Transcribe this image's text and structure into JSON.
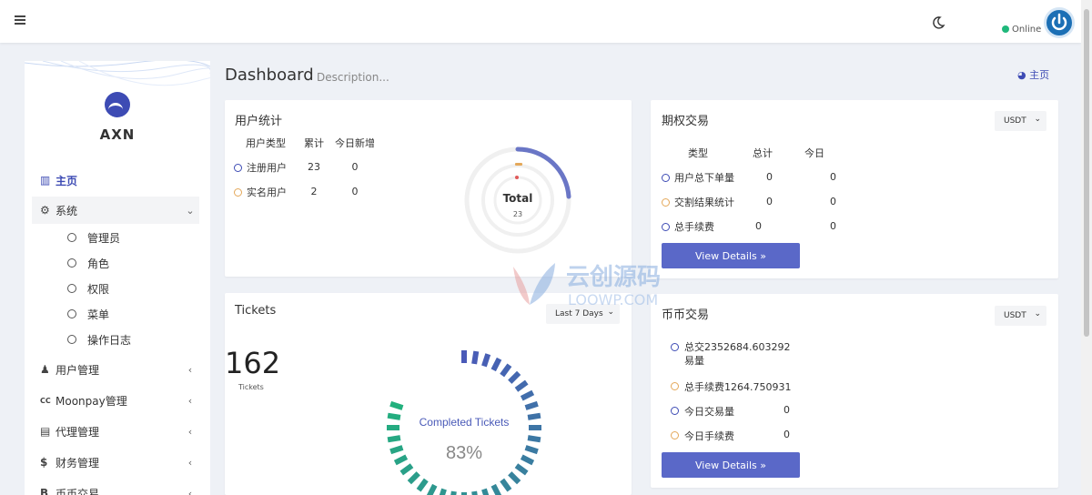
{
  "header": {
    "status": "Online"
  },
  "sidebar": {
    "brand": "AXN",
    "items": [
      {
        "label": "主页",
        "icon": "bar-chart-icon"
      },
      {
        "label": "系统",
        "icon": "gear-icon"
      },
      {
        "label": "用户管理",
        "icon": "users-icon"
      },
      {
        "label": "Moonpay管理",
        "icon": "cc-icon"
      },
      {
        "label": "代理管理",
        "icon": "id-card-icon"
      },
      {
        "label": "财务管理",
        "icon": "dollar-icon"
      },
      {
        "label": "币币交易",
        "icon": "bitcoin-icon"
      }
    ],
    "system_sub": [
      "管理员",
      "角色",
      "权限",
      "菜单",
      "操作日志"
    ]
  },
  "page": {
    "title": "Dashboard",
    "description": "Description...",
    "breadcrumb": "主页"
  },
  "user_stats": {
    "title": "用户统计",
    "headers": [
      "用户类型",
      "累计",
      "今日新增"
    ],
    "rows": [
      {
        "type": "注册用户",
        "total": "23",
        "today": "0"
      },
      {
        "type": "实名用户",
        "total": "2",
        "today": "0"
      }
    ],
    "donut_label": "Total",
    "donut_value": "23"
  },
  "options_trade": {
    "title": "期权交易",
    "currency": "USDT",
    "headers": [
      "类型",
      "总计",
      "今日"
    ],
    "rows": [
      {
        "type": "用户总下单量",
        "total": "0",
        "today": "0"
      },
      {
        "type": "交割结果统计",
        "total": "0",
        "today": "0"
      },
      {
        "type": "总手续费",
        "total": "0",
        "today": "0"
      }
    ],
    "button": "View Details »"
  },
  "tickets": {
    "title": "Tickets",
    "range": "Last 7 Days",
    "count": "162",
    "count_label": "Tickets",
    "gauge_label": "Completed Tickets",
    "gauge_value": "83%",
    "gauge_fraction": 0.83
  },
  "coin_trade": {
    "title": "币币交易",
    "currency": "USDT",
    "rows": [
      {
        "label": "总交2352684.603292",
        "label2": "易量",
        "value": ""
      },
      {
        "label": "总手续费1264.750931",
        "value": ""
      },
      {
        "label": "今日交易量",
        "value": "0"
      },
      {
        "label": "今日手续费",
        "value": "0"
      }
    ],
    "button": "View Details »"
  },
  "watermark": {
    "text": "云创源码",
    "sub": "LOOWP.COM"
  },
  "colors": {
    "accent": "#3d4bb4",
    "button": "#5a68c8",
    "online": "#1fb87b",
    "orange": "#e4a85a"
  }
}
